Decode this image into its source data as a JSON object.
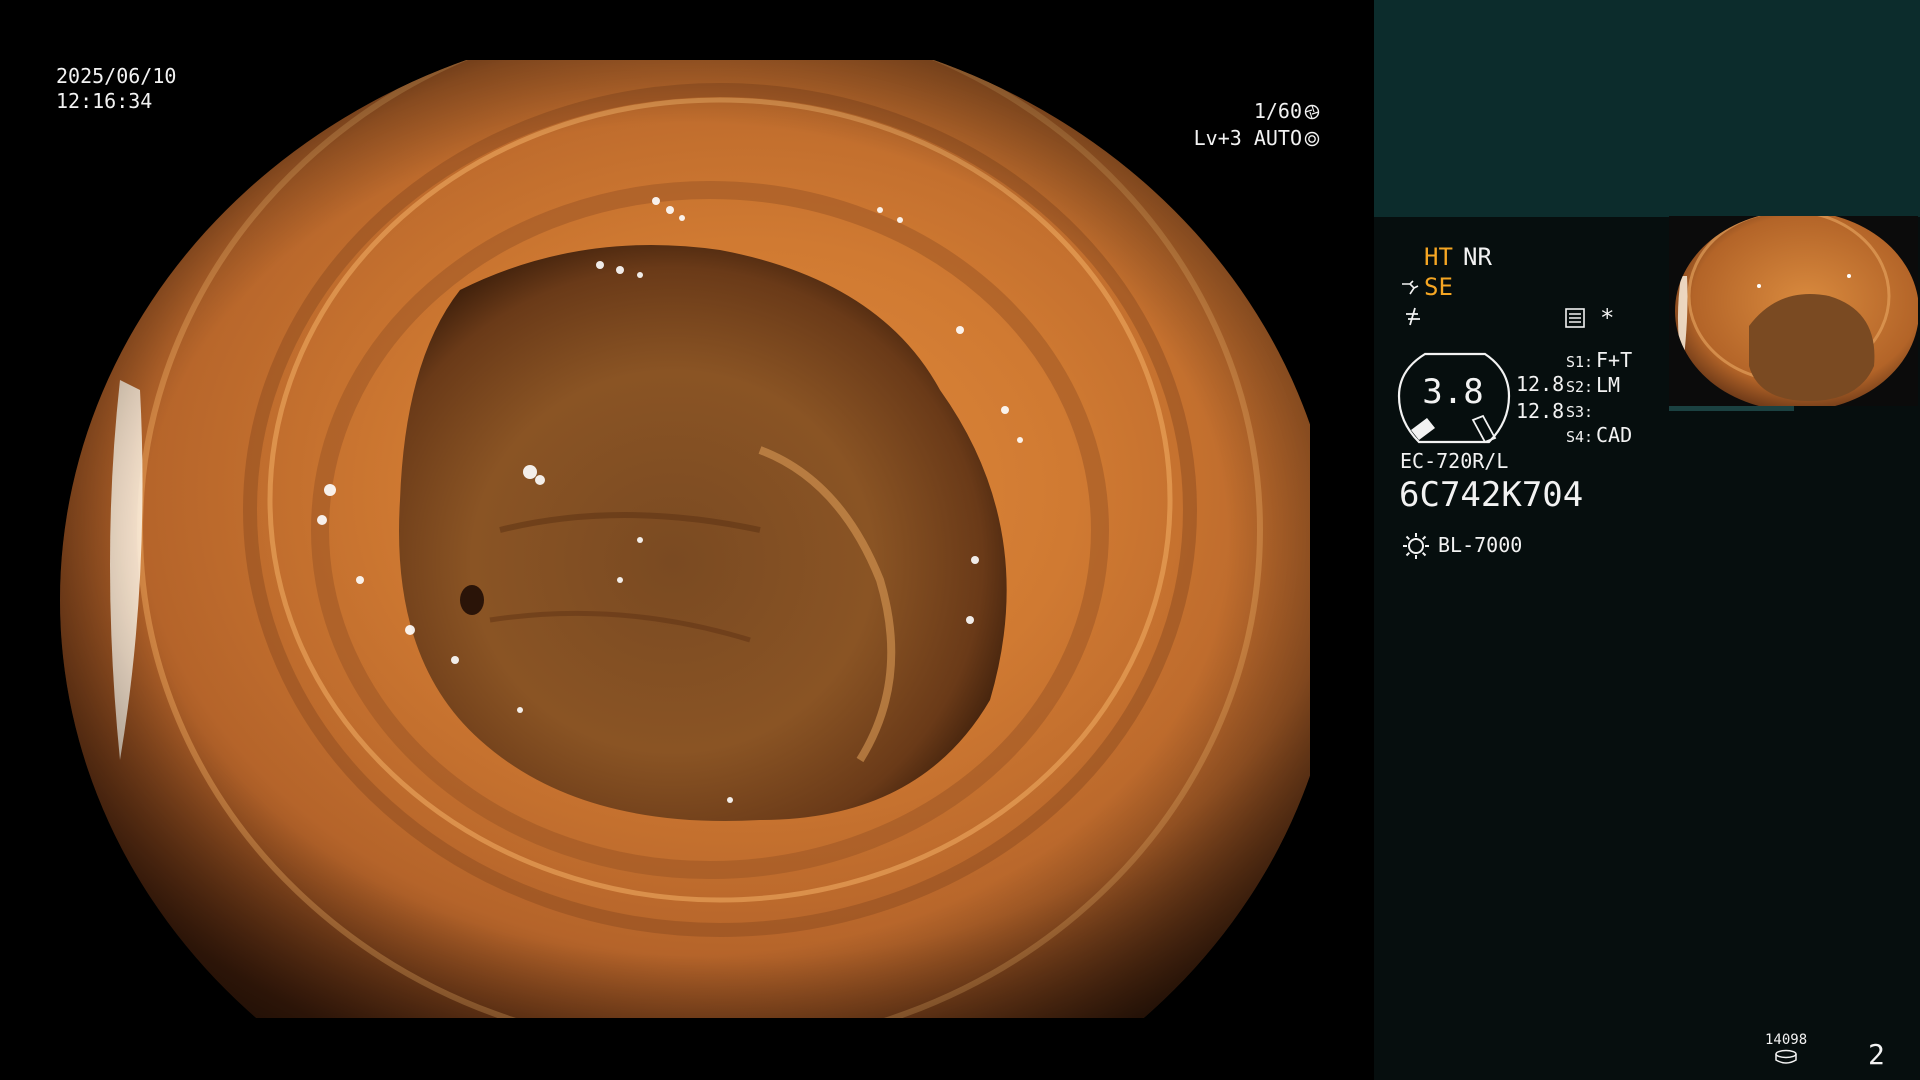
{
  "overlay": {
    "date": "2025/06/10",
    "time": "12:16:34",
    "shutter": "1/60",
    "iris": "Lv+3 AUTO"
  },
  "panel": {
    "ht": "HT",
    "nr": "NR",
    "se": "SE",
    "star": "*",
    "gauge_value": "3.8",
    "value_1": "12.8",
    "value_2": "12.8",
    "switches": [
      {
        "label": "S1:",
        "value": "F+T"
      },
      {
        "label": "S2:",
        "value": "LM"
      },
      {
        "label": "S3:",
        "value": ""
      },
      {
        "label": "S4:",
        "value": "CAD"
      }
    ],
    "scope_model": "EC-720R/L",
    "scope_serial": "6C742K704",
    "light_source": "BL-7000",
    "image_counter": "14098",
    "page_number": "2"
  },
  "colors": {
    "accent_orange": "#f5a623",
    "panel_top": "#0c2c2c",
    "panel_body": "#060e0e",
    "mucosa": "#c07030"
  },
  "icons": {
    "shutter": "aperture-icon",
    "iris": "iris-icon",
    "se": "structure-enhance-icon",
    "enhance": "enhance-icon",
    "menu": "menu-icon",
    "light": "light-source-icon",
    "disk": "disk-icon"
  }
}
